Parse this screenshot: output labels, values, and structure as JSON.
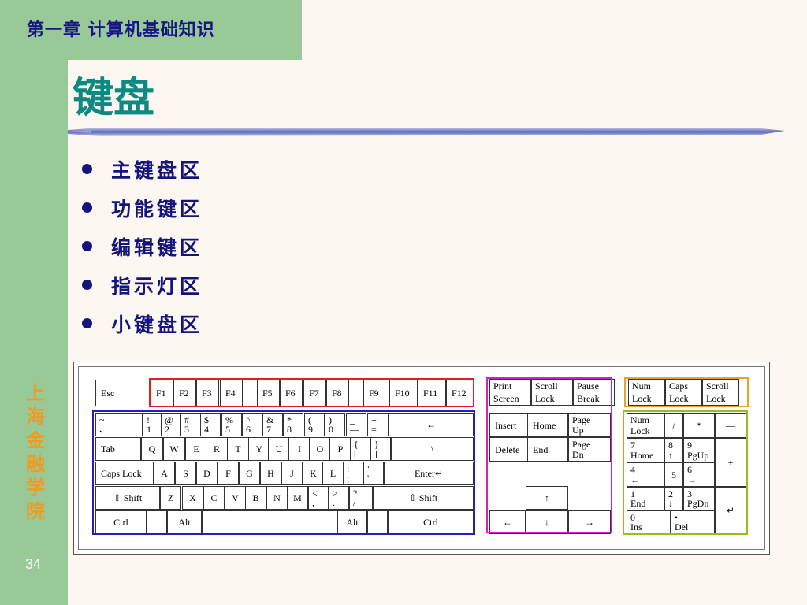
{
  "header": {
    "chapter": "第一章  计算机基础知识"
  },
  "title": "键盘",
  "bullets": [
    "主键盘区",
    "功能键区",
    "编辑键区",
    "指示灯区",
    "小键盘区"
  ],
  "sidebar": {
    "school": [
      "上",
      "海",
      "金",
      "融",
      "学",
      "院"
    ],
    "page_number": "34"
  },
  "colors": {
    "sidebar": "#99c997",
    "title": "#0c8a82",
    "bullet_text": "#14147c",
    "school_text": "#f29a1e",
    "zone_function": "#e02020",
    "zone_main": "#2020c0",
    "zone_edit": "#d020d0",
    "zone_indicator": "#f0a030",
    "zone_numpad": "#90c020"
  },
  "keyboard": {
    "esc": "Esc",
    "function_keys": [
      "F1",
      "F2",
      "F3",
      "F4",
      "F5",
      "F6",
      "F7",
      "F8",
      "F9",
      "F10",
      "F11",
      "F12"
    ],
    "system_keys": [
      [
        "Print",
        "Screen"
      ],
      [
        "Scroll",
        "Lock"
      ],
      [
        "Pause",
        "Break"
      ]
    ],
    "indicators": [
      [
        "Num",
        "Lock"
      ],
      [
        "Caps",
        "Lock"
      ],
      [
        "Scroll",
        "Lock"
      ]
    ],
    "number_row": [
      [
        "~",
        "、"
      ],
      [
        "!",
        "1"
      ],
      [
        "@",
        "2"
      ],
      [
        "#",
        "3"
      ],
      [
        "$",
        "4"
      ],
      [
        "%",
        "5"
      ],
      [
        "^",
        "6"
      ],
      [
        "&",
        "7"
      ],
      [
        "*",
        "8"
      ],
      [
        "(",
        "9"
      ],
      [
        ")",
        "0"
      ],
      [
        "_",
        "—"
      ],
      [
        "+",
        "="
      ]
    ],
    "backspace": "←",
    "tab": "Tab",
    "qwerty": [
      "Q",
      "W",
      "E",
      "R",
      "T",
      "Y",
      "U",
      "I",
      "O",
      "P"
    ],
    "bracket_keys": [
      [
        "{",
        "["
      ],
      [
        "}",
        "]"
      ]
    ],
    "backslash": "\\",
    "caps_lock": "Caps Lock",
    "asdf": [
      "A",
      "S",
      "D",
      "F",
      "G",
      "H",
      "J",
      "K",
      "L"
    ],
    "semicolon_keys": [
      [
        ":",
        ";"
      ],
      [
        "\"",
        "'"
      ]
    ],
    "enter": "Enter",
    "enter_arrow": "↵",
    "shift": "⇧ Shift",
    "zxcv": [
      "Z",
      "X",
      "C",
      "V",
      "B",
      "N",
      "M"
    ],
    "comma_keys": [
      [
        "<",
        ","
      ],
      [
        ">",
        "."
      ],
      [
        "?",
        "/"
      ]
    ],
    "ctrl": "Ctrl",
    "alt": "Alt",
    "edit_keys": [
      [
        "Insert"
      ],
      [
        "Home"
      ],
      [
        "Page",
        "Up"
      ],
      [
        "Delete"
      ],
      [
        "End"
      ],
      [
        "Page",
        "Dn"
      ]
    ],
    "arrows": {
      "up": "↑",
      "left": "←",
      "down": "↓",
      "right": "→"
    },
    "numpad": {
      "numlock": [
        "Num",
        "Lock"
      ],
      "divide": "/",
      "multiply": "*",
      "minus": "—",
      "k7": [
        "7",
        "Home"
      ],
      "k8": [
        "8",
        "↑"
      ],
      "k9": [
        "9",
        "PgUp"
      ],
      "plus": "+",
      "k4": [
        "4",
        "←"
      ],
      "k5": "5",
      "k6": [
        "6",
        "→"
      ],
      "k1": [
        "1",
        "End"
      ],
      "k2": [
        "2",
        "↓"
      ],
      "k3": [
        "3",
        "PgDn"
      ],
      "enter": "↵",
      "k0": [
        "0",
        "Ins"
      ],
      "dot": [
        "•",
        "Del"
      ]
    }
  }
}
